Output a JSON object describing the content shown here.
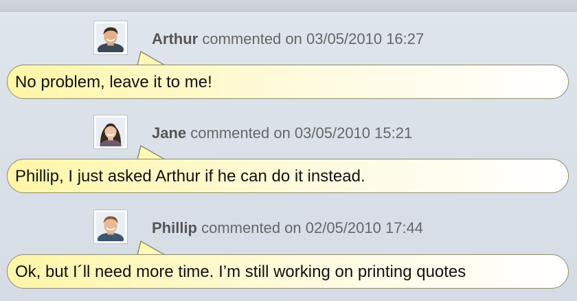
{
  "comments": [
    {
      "author": "Arthur",
      "action": "commented on 03/05/2010 16:27",
      "text": "No problem, leave it to me!",
      "avatar": "male-avatar-dark-hair"
    },
    {
      "author": "Jane",
      "action": "commented on 03/05/2010 15:21",
      "text": "Phillip, I just asked Arthur if he can do it instead.",
      "avatar": "female-avatar"
    },
    {
      "author": "Phillip",
      "action": "commented on 02/05/2010 17:44",
      "text": "Ok, but I´ll need more time. I’m still working on printing quotes",
      "avatar": "male-avatar-light-hair"
    }
  ],
  "colors": {
    "bubble_yellow": "#fff6a8",
    "bubble_border": "#8d8d6a",
    "background": "#dfe5ec"
  }
}
